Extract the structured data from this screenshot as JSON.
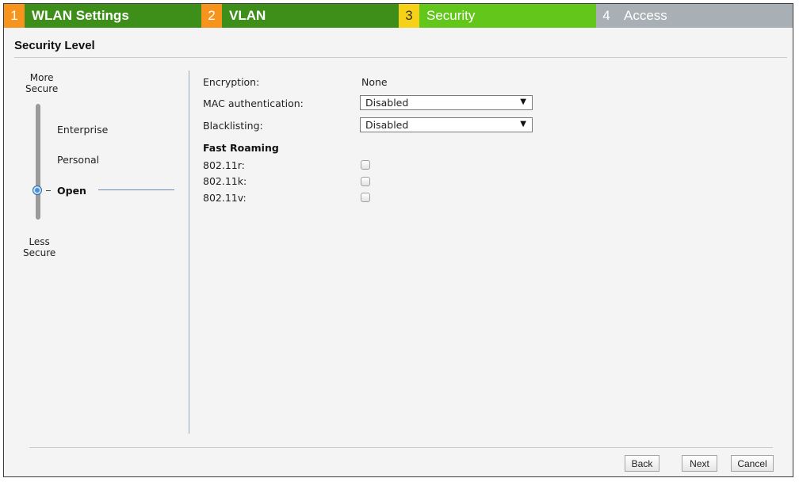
{
  "steps": [
    {
      "num": "1",
      "label": "WLAN Settings"
    },
    {
      "num": "2",
      "label": "VLAN"
    },
    {
      "num": "3",
      "label": "Security"
    },
    {
      "num": "4",
      "label": "Access"
    }
  ],
  "section": {
    "title": "Security Level"
  },
  "security_level": {
    "top_label_line1": "More",
    "top_label_line2": "Secure",
    "bottom_label_line1": "Less",
    "bottom_label_line2": "Secure",
    "options": [
      "Enterprise",
      "Personal",
      "Open"
    ],
    "selected": "Open"
  },
  "form": {
    "encryption_label": "Encryption:",
    "encryption_value": "None",
    "mac_label": "MAC authentication:",
    "mac_value": "Disabled",
    "blacklist_label": "Blacklisting:",
    "blacklist_value": "Disabled",
    "fast_roaming_title": "Fast Roaming",
    "r_label": "802.11r:",
    "k_label": "802.11k:",
    "v_label": "802.11v:"
  },
  "buttons": {
    "back": "Back",
    "next": "Next",
    "cancel": "Cancel"
  },
  "colors": {
    "step_num_done": "#f7941d",
    "step_done": "#3d8f1a",
    "step_num_current": "#f7d117",
    "step_current": "#63c61a",
    "step_pending": "#a8b0b5"
  }
}
